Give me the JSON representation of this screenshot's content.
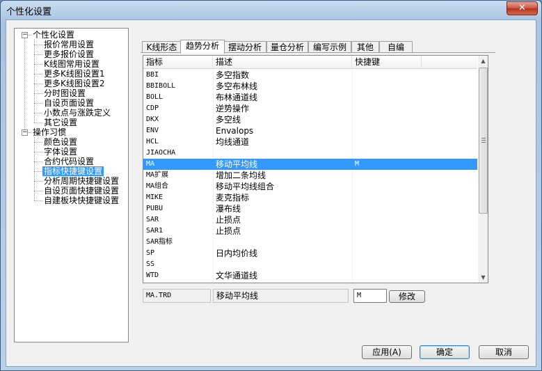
{
  "window": {
    "title": "个性化设置",
    "close_glyph": "✕"
  },
  "tree": {
    "groups": [
      {
        "label": "个性化设置",
        "expander": "−",
        "items": [
          "报价常用设置",
          "更多报价设置",
          "K线图常用设置",
          "更多K线图设置1",
          "更多K线图设置2",
          "分时图设置",
          "自设页面设置",
          "小数点与涨跌定义",
          "其它设置"
        ]
      },
      {
        "label": "操作习惯",
        "expander": "−",
        "items": [
          "颜色设置",
          "字体设置",
          "合约代码设置",
          "指标快捷键设置",
          "分析周期快捷键设置",
          "自设页面快捷键设置",
          "自建板块快捷键设置"
        ]
      }
    ],
    "selected": "指标快捷键设置"
  },
  "tabs": [
    "K线形态",
    "趋势分析",
    "摆动分析",
    "量仓分析",
    "编写示例",
    "其他",
    "自编"
  ],
  "active_tab": "趋势分析",
  "list": {
    "columns": [
      "指标",
      "描述",
      "快捷键"
    ],
    "rows": [
      [
        "BBI",
        "多空指数",
        ""
      ],
      [
        "BBIBOLL",
        "多空布林线",
        ""
      ],
      [
        "BOLL",
        "布林通道线",
        ""
      ],
      [
        "CDP",
        "逆势操作",
        ""
      ],
      [
        "DKX",
        "多空线",
        ""
      ],
      [
        "ENV",
        "Envalops",
        ""
      ],
      [
        "HCL",
        "均线通道",
        ""
      ],
      [
        "JIAOCHA",
        "",
        ""
      ],
      [
        "MA",
        "移动平均线",
        "M"
      ],
      [
        "MA扩展",
        "增加二条均线",
        ""
      ],
      [
        "MA组合",
        "移动平均线组合",
        ""
      ],
      [
        "MIKE",
        "麦克指标",
        ""
      ],
      [
        "PUBU",
        "瀑布线",
        ""
      ],
      [
        "SAR",
        "止损点",
        ""
      ],
      [
        "SAR1",
        "止损点",
        ""
      ],
      [
        "SAR指标",
        "",
        ""
      ],
      [
        "SP",
        "日内均价线",
        ""
      ],
      [
        "SS",
        "",
        ""
      ],
      [
        "WTD",
        "文华通道线",
        ""
      ]
    ],
    "selected_index": 8
  },
  "detail": {
    "file": "MA.TRD",
    "description": "移动平均线",
    "shortcut": "M",
    "modify_label": "修改"
  },
  "buttons": {
    "apply": "应用(A)",
    "ok": "确定",
    "cancel": "取消"
  }
}
